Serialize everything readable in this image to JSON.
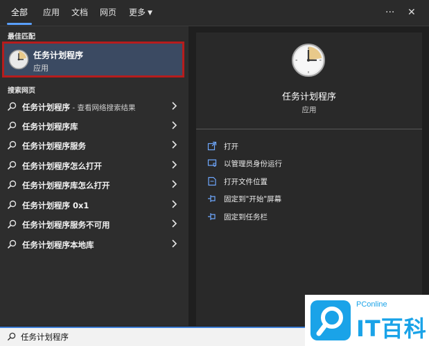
{
  "tabs": [
    {
      "label": "全部"
    },
    {
      "label": "应用"
    },
    {
      "label": "文档"
    },
    {
      "label": "网页"
    },
    {
      "label": "更多"
    }
  ],
  "topbar": {
    "more_icon": "ellipsis-icon",
    "close_icon": "close-icon"
  },
  "best_match": {
    "heading": "最佳匹配",
    "name": "任务计划程序",
    "type": "应用",
    "icon": "clock-icon"
  },
  "web_search": {
    "heading": "搜索网页",
    "items": [
      {
        "text": "任务计划程序",
        "suffix": " - 查看网络搜索结果"
      },
      {
        "text": "任务计划程序库",
        "suffix": ""
      },
      {
        "text": "任务计划程序服务",
        "suffix": ""
      },
      {
        "text": "任务计划程序怎么打开",
        "suffix": ""
      },
      {
        "text": "任务计划程序库怎么打开",
        "suffix": ""
      },
      {
        "text": "任务计划程序 0x1",
        "suffix": ""
      },
      {
        "text": "任务计划程序服务不可用",
        "suffix": ""
      },
      {
        "text": "任务计划程序本地库",
        "suffix": ""
      }
    ]
  },
  "preview": {
    "name": "任务计划程序",
    "type": "应用",
    "actions": [
      {
        "label": "打开",
        "icon": "open-icon"
      },
      {
        "label": "以管理员身份运行",
        "icon": "shield-icon"
      },
      {
        "label": "打开文件位置",
        "icon": "folder-icon"
      },
      {
        "label": "固定到\"开始\"屏幕",
        "icon": "pin-icon"
      },
      {
        "label": "固定到任务栏",
        "icon": "pin-icon"
      }
    ]
  },
  "search": {
    "value": "任务计划程序"
  },
  "watermark": {
    "small": "PConline",
    "big": "IT百科"
  },
  "colors": {
    "accent": "#5aa0ff",
    "highlight_border": "#b71c1c",
    "selected_bg": "#3b4a62",
    "watermark": "#1aa3e8"
  }
}
